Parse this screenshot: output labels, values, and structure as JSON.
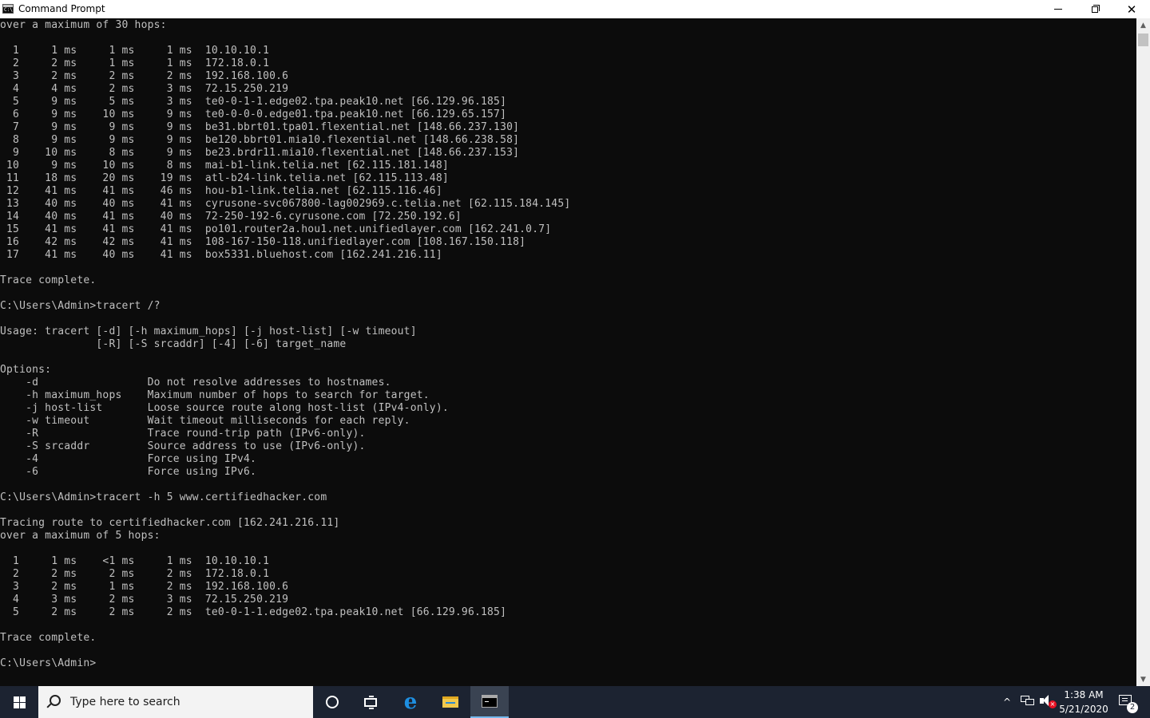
{
  "window": {
    "title": "Command Prompt",
    "minimize_glyph": "",
    "close_glyph": "✕",
    "icon_label": "C:\\"
  },
  "console": {
    "text": "over a maximum of 30 hops:\n\n  1     1 ms     1 ms     1 ms  10.10.10.1\n  2     2 ms     1 ms     1 ms  172.18.0.1\n  3     2 ms     2 ms     2 ms  192.168.100.6\n  4     4 ms     2 ms     3 ms  72.15.250.219\n  5     9 ms     5 ms     3 ms  te0-0-1-1.edge02.tpa.peak10.net [66.129.96.185]\n  6     9 ms    10 ms     9 ms  te0-0-0-0.edge01.tpa.peak10.net [66.129.65.157]\n  7     9 ms     9 ms     9 ms  be31.bbrt01.tpa01.flexential.net [148.66.237.130]\n  8     9 ms     9 ms     9 ms  be120.bbrt01.mia10.flexential.net [148.66.238.58]\n  9    10 ms     8 ms     9 ms  be23.brdr11.mia10.flexential.net [148.66.237.153]\n 10     9 ms    10 ms     8 ms  mai-b1-link.telia.net [62.115.181.148]\n 11    18 ms    20 ms    19 ms  atl-b24-link.telia.net [62.115.113.48]\n 12    41 ms    41 ms    46 ms  hou-b1-link.telia.net [62.115.116.46]\n 13    40 ms    40 ms    41 ms  cyrusone-svc067800-lag002969.c.telia.net [62.115.184.145]\n 14    40 ms    41 ms    40 ms  72-250-192-6.cyrusone.com [72.250.192.6]\n 15    41 ms    41 ms    41 ms  po101.router2a.hou1.net.unifiedlayer.com [162.241.0.7]\n 16    42 ms    42 ms    41 ms  108-167-150-118.unifiedlayer.com [108.167.150.118]\n 17    41 ms    40 ms    41 ms  box5331.bluehost.com [162.241.216.11]\n\nTrace complete.\n\nC:\\Users\\Admin>tracert /?\n\nUsage: tracert [-d] [-h maximum_hops] [-j host-list] [-w timeout]\n               [-R] [-S srcaddr] [-4] [-6] target_name\n\nOptions:\n    -d                 Do not resolve addresses to hostnames.\n    -h maximum_hops    Maximum number of hops to search for target.\n    -j host-list       Loose source route along host-list (IPv4-only).\n    -w timeout         Wait timeout milliseconds for each reply.\n    -R                 Trace round-trip path (IPv6-only).\n    -S srcaddr         Source address to use (IPv6-only).\n    -4                 Force using IPv4.\n    -6                 Force using IPv6.\n\nC:\\Users\\Admin>tracert -h 5 www.certifiedhacker.com\n\nTracing route to certifiedhacker.com [162.241.216.11]\nover a maximum of 5 hops:\n\n  1     1 ms    <1 ms     1 ms  10.10.10.1\n  2     2 ms     2 ms     2 ms  172.18.0.1\n  3     2 ms     1 ms     2 ms  192.168.100.6\n  4     3 ms     2 ms     3 ms  72.15.250.219\n  5     2 ms     2 ms     2 ms  te0-0-1-1.edge02.tpa.peak10.net [66.129.96.185]\n\nTrace complete.\n\nC:\\Users\\Admin>"
  },
  "taskbar": {
    "search_placeholder": "Type here to search",
    "edge_glyph": "e",
    "tray_chevron": "^",
    "time": "1:38 AM",
    "date": "5/21/2020",
    "notification_count": "2",
    "volume_muted_glyph": "×"
  },
  "colors": {
    "console_bg": "#0c0c0c",
    "console_fg": "#c0c0c0",
    "taskbar_bg": "#1c2331",
    "active_indicator": "#76b9ed"
  }
}
